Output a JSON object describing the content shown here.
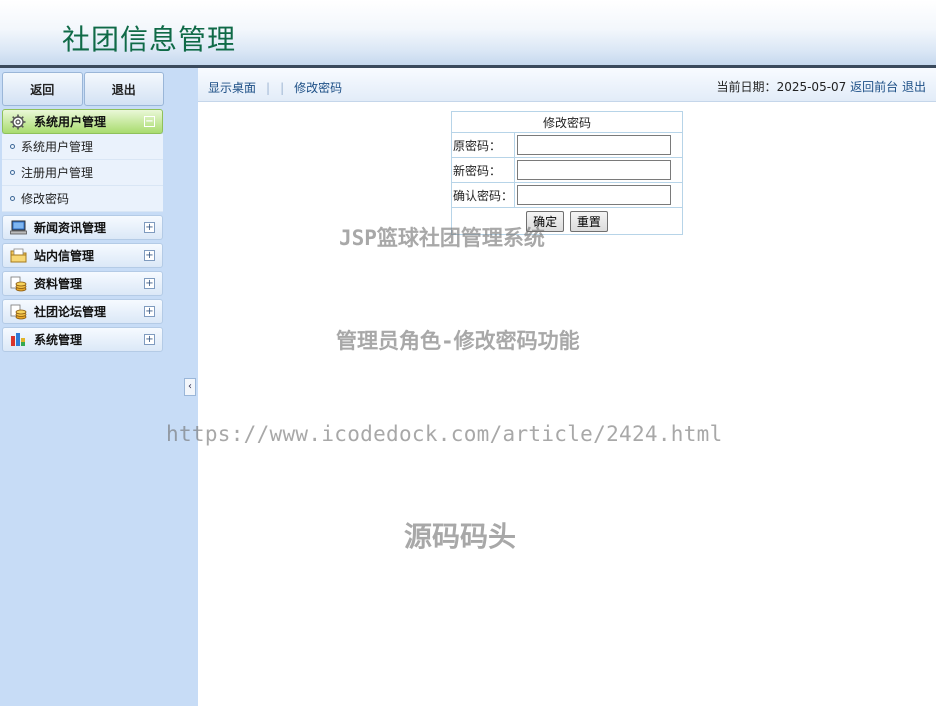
{
  "header": {
    "title": "社团信息管理"
  },
  "sidebar": {
    "top_buttons": {
      "back": "返回",
      "logout": "退出"
    },
    "groups": [
      {
        "label": "系统用户管理",
        "icon": "gear-icon",
        "expanded": true,
        "toggle": "−",
        "items": [
          "系统用户管理",
          "注册用户管理",
          "修改密码"
        ]
      },
      {
        "label": "新闻资讯管理",
        "icon": "monitor-icon",
        "toggle": "+"
      },
      {
        "label": "站内信管理",
        "icon": "folder-icon",
        "toggle": "+"
      },
      {
        "label": "资料管理",
        "icon": "coins-icon",
        "toggle": "+"
      },
      {
        "label": "社团论坛管理",
        "icon": "coins-icon",
        "toggle": "+"
      },
      {
        "label": "系统管理",
        "icon": "bar-chart-icon",
        "toggle": "+"
      }
    ],
    "collapse_glyph": "‹"
  },
  "topbar": {
    "nav": {
      "desktop": "显示桌面",
      "change_password": "修改密码"
    },
    "date_label": "当前日期：",
    "date_value": "2025-05-07",
    "back_front": "返回前台",
    "logout": "退出"
  },
  "form": {
    "caption": "修改密码",
    "old_password_label": "原密码：",
    "new_password_label": "新密码：",
    "confirm_password_label": "确认密码：",
    "old_password_value": "",
    "new_password_value": "",
    "confirm_password_value": "",
    "submit_label": "确定",
    "reset_label": "重置"
  },
  "watermarks": {
    "line1": "JSP篮球社团管理系统",
    "line2": "管理员角色-修改密码功能",
    "line3": "https://www.icodedock.com/article/2424.html",
    "line4": "源码码头"
  },
  "colors": {
    "title_green": "#0f6a47",
    "link_blue": "#1d4f86",
    "sidebar_bg": "#c7dcf6",
    "active_group": "#a9dc6f"
  }
}
